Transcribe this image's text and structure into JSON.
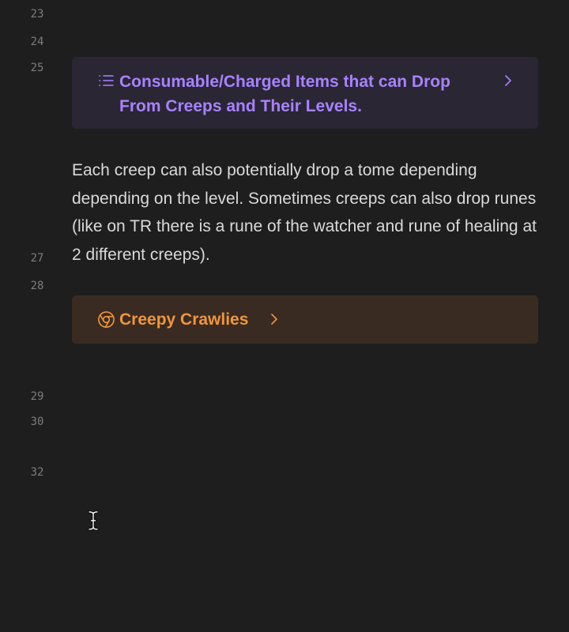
{
  "gutter": {
    "lines": [
      "23",
      "24",
      "25",
      "27",
      "28",
      "29",
      "30",
      "32"
    ]
  },
  "toc_callout": {
    "icon": "list-icon",
    "title": "Consumable/Charged Items that can Drop From Creeps and Their Levels.",
    "color": "#a882ff"
  },
  "paragraph": {
    "text": "Each creep can also potentially drop a tome depending depending on the level. Sometimes creeps can also drop runes (like on TR there is a rune of the watcher and rune of healing at 2 different creeps)."
  },
  "link_callout": {
    "icon": "chrome-icon",
    "title": "Creepy Crawlies",
    "color": "#f0953e"
  }
}
